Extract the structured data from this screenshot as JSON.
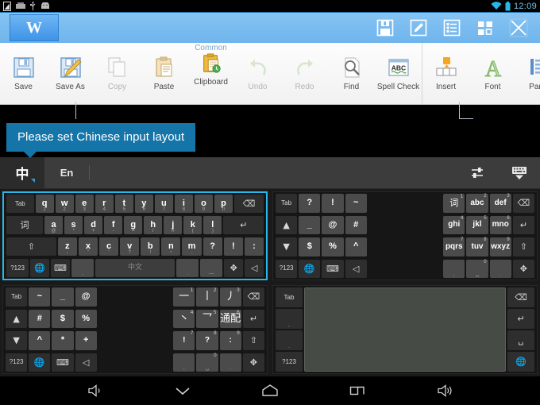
{
  "status_bar": {
    "icons": [
      "screenshot-icon",
      "sdcard-icon",
      "usb-icon",
      "android-debug-icon"
    ],
    "wifi": "wifi-icon",
    "battery": "battery-icon",
    "time": "12:09"
  },
  "title_bar": {
    "app_logo": "W",
    "actions": [
      {
        "name": "save-icon",
        "label": "Save"
      },
      {
        "name": "edit-icon",
        "label": "Edit"
      },
      {
        "name": "outline-icon",
        "label": "Outline"
      },
      {
        "name": "apps-grid-icon",
        "label": "Apps"
      },
      {
        "name": "close-icon",
        "label": "Close"
      }
    ]
  },
  "ribbon": {
    "group_label": "Common",
    "groups": [
      {
        "items": [
          {
            "label": "Save",
            "icon": "floppy-disk-icon",
            "dim": false
          },
          {
            "label": "Save As",
            "icon": "floppy-pencil-icon",
            "dim": false
          },
          {
            "label": "Copy",
            "icon": "copy-pages-icon",
            "dim": true
          },
          {
            "label": "Paste",
            "icon": "clipboard-paste-icon",
            "dim": false
          },
          {
            "label": "Clipboard",
            "icon": "clipboard-clock-icon",
            "dim": false
          },
          {
            "label": "Undo",
            "icon": "undo-arrow-icon",
            "dim": true
          },
          {
            "label": "Redo",
            "icon": "redo-arrow-icon",
            "dim": true
          },
          {
            "label": "Find",
            "icon": "magnifier-page-icon",
            "dim": false
          },
          {
            "label": "Spell Check",
            "icon": "abc-spell-icon",
            "dim": false
          }
        ]
      },
      {
        "items": [
          {
            "label": "Insert",
            "icon": "insert-cell-icon",
            "dim": false
          },
          {
            "label": "Font",
            "icon": "font-a-icon",
            "dim": false
          },
          {
            "label": "Parag",
            "icon": "paragraph-icon",
            "dim": false
          }
        ]
      }
    ]
  },
  "tooltip": {
    "text": "Please set Chinese input layout"
  },
  "ime_bar": {
    "tabs": [
      {
        "label": "中",
        "name": "tab-chinese",
        "active": true
      },
      {
        "label": "En",
        "name": "tab-english",
        "active": false
      }
    ],
    "right_buttons": [
      {
        "name": "ime-settings-icon",
        "label": "Settings"
      },
      {
        "name": "hide-keyboard-icon",
        "label": "Hide keyboard"
      }
    ]
  },
  "keyboards": {
    "qwerty": {
      "name": "qwerty-panel",
      "selected": true,
      "rows": [
        [
          {
            "main": "Tab",
            "fn": true
          },
          {
            "main": "q",
            "sub": "1"
          },
          {
            "main": "w",
            "sub": "2"
          },
          {
            "main": "e",
            "sub": "3"
          },
          {
            "main": "r",
            "sub": "4"
          },
          {
            "main": "t",
            "sub": "5"
          },
          {
            "main": "y",
            "sub": "6"
          },
          {
            "main": "u",
            "sub": "7"
          },
          {
            "main": "i",
            "sub": "8"
          },
          {
            "main": "o",
            "sub": "9"
          },
          {
            "main": "p",
            "sub": "0"
          },
          {
            "main": "⌫",
            "fn": true,
            "glyph": true,
            "name": "backspace-key"
          }
        ],
        [
          {
            "main": "词",
            "fn": true,
            "glyph": true,
            "name": "word-key"
          },
          {
            "main": "a",
            "sub": "@"
          },
          {
            "main": "s",
            "sub": "*"
          },
          {
            "main": "d",
            "sub": "+"
          },
          {
            "main": "f",
            "sub": "-"
          },
          {
            "main": "g",
            "sub": "="
          },
          {
            "main": "h",
            "sub": "/"
          },
          {
            "main": "j",
            "sub": "#"
          },
          {
            "main": "k",
            "sub": "("
          },
          {
            "main": "l",
            "sub": ")"
          },
          {
            "main": "↵",
            "fn": true,
            "glyph": true,
            "name": "enter-key"
          }
        ],
        [
          {
            "main": "⇧",
            "fn": true,
            "glyph": true,
            "name": "shift-key"
          },
          {
            "main": "z",
            "sub": ","
          },
          {
            "main": "x",
            "sub": "\""
          },
          {
            "main": "c",
            "sub": "'"
          },
          {
            "main": "v",
            "sub": "?"
          },
          {
            "main": "b",
            "sub": "!"
          },
          {
            "main": "n",
            "sub": "~"
          },
          {
            "main": "m",
            "sub": "."
          },
          {
            "main": "?",
            "sub": ""
          },
          {
            "main": "!",
            "sub": ""
          },
          {
            "main": ":",
            "sub": ""
          }
        ],
        [
          {
            "main": "?123",
            "fn": true,
            "name": "symbols-key"
          },
          {
            "main": "🌐",
            "fn": true,
            "glyph": true,
            "name": "language-key"
          },
          {
            "main": "⌨",
            "fn": true,
            "glyph": true,
            "name": "keyboard-layout-key"
          },
          {
            "main": "",
            "sub": ",",
            "name": "comma-key"
          },
          {
            "main": "中文",
            "space": true,
            "name": "space-key"
          },
          {
            "main": "",
            "sub": ".",
            "name": "period-key"
          },
          {
            "main": "",
            "sub": "—",
            "name": "dash-key"
          },
          {
            "main": "✥",
            "fn": true,
            "glyph": true,
            "name": "cursor-move-key"
          },
          {
            "main": "◁",
            "fn": true,
            "glyph": true,
            "name": "hide-key"
          }
        ]
      ]
    },
    "t9": {
      "name": "t9-panel",
      "left_rows": [
        [
          {
            "main": "Tab",
            "fn": true
          },
          {
            "main": "?"
          },
          {
            "main": "!"
          },
          {
            "main": "~"
          }
        ],
        [
          {
            "main": "▲",
            "fn": true,
            "glyph": true,
            "name": "page-up-key"
          },
          {
            "main": "_"
          },
          {
            "main": "@"
          },
          {
            "main": "#"
          }
        ],
        [
          {
            "main": "▼",
            "fn": true,
            "glyph": true,
            "name": "page-down-key"
          },
          {
            "main": "$"
          },
          {
            "main": "%"
          },
          {
            "main": "^"
          }
        ],
        [
          {
            "main": "?123",
            "fn": true
          },
          {
            "main": "🌐",
            "fn": true,
            "glyph": true
          },
          {
            "main": "⌨",
            "fn": true,
            "glyph": true
          },
          {
            "main": "◁",
            "fn": true,
            "glyph": true
          }
        ]
      ],
      "pad_rows": [
        [
          {
            "main": "词",
            "sup": "1",
            "glyph": true
          },
          {
            "main": "abc",
            "sup": "2"
          },
          {
            "main": "def",
            "sup": "3"
          },
          {
            "main": "⌫",
            "fn": true,
            "glyph": true,
            "name": "backspace-key"
          }
        ],
        [
          {
            "main": "ghi",
            "sup": "4"
          },
          {
            "main": "jkl",
            "sup": "5"
          },
          {
            "main": "mno",
            "sup": "6"
          },
          {
            "main": "↵",
            "fn": true,
            "glyph": true,
            "name": "enter-key"
          }
        ],
        [
          {
            "main": "pqrs",
            "sup": "7"
          },
          {
            "main": "tuv",
            "sup": "8"
          },
          {
            "main": "wxyz",
            "sup": "9"
          },
          {
            "main": "⇧",
            "fn": true,
            "glyph": true,
            "name": "shift-key"
          }
        ],
        [
          {
            "main": "",
            "sub": ","
          },
          {
            "main": "",
            "sup": "0",
            "sub": "␣"
          },
          {
            "main": "",
            "sub": "."
          },
          {
            "main": "✥",
            "fn": true,
            "glyph": true,
            "name": "cursor-move-key"
          }
        ]
      ]
    },
    "stroke": {
      "name": "stroke-panel",
      "left_rows": [
        [
          {
            "main": "Tab",
            "fn": true
          },
          {
            "main": "~"
          },
          {
            "main": "_"
          },
          {
            "main": "@"
          }
        ],
        [
          {
            "main": "▲",
            "fn": true,
            "glyph": true,
            "name": "page-up-key"
          },
          {
            "main": "#"
          },
          {
            "main": "$"
          },
          {
            "main": "%"
          }
        ],
        [
          {
            "main": "▼",
            "fn": true,
            "glyph": true,
            "name": "page-down-key"
          },
          {
            "main": "^"
          },
          {
            "main": "*"
          },
          {
            "main": "+"
          }
        ],
        [
          {
            "main": "?123",
            "fn": true
          },
          {
            "main": "🌐",
            "fn": true,
            "glyph": true
          },
          {
            "main": "⌨",
            "fn": true,
            "glyph": true
          },
          {
            "main": "◁",
            "fn": true,
            "glyph": true
          }
        ]
      ],
      "pad_rows": [
        [
          {
            "main": "一",
            "sup": "1",
            "stroke": true
          },
          {
            "main": "丨",
            "sup": "2",
            "stroke": true
          },
          {
            "main": "丿",
            "sup": "3",
            "stroke": true
          },
          {
            "main": "⌫",
            "fn": true,
            "glyph": true,
            "name": "backspace-key"
          }
        ],
        [
          {
            "main": "丶",
            "sup": "4",
            "stroke": true
          },
          {
            "main": "乛",
            "sup": "5",
            "stroke": true
          },
          {
            "main": "通配",
            "sup": "6",
            "stroke": true
          },
          {
            "main": "↵",
            "fn": true,
            "glyph": true,
            "name": "enter-key"
          }
        ],
        [
          {
            "main": "!",
            "sup": "7"
          },
          {
            "main": "?",
            "sup": "8"
          },
          {
            "main": ":",
            "sup": "9"
          },
          {
            "main": "⇧",
            "fn": true,
            "glyph": true,
            "name": "shift-key"
          }
        ],
        [
          {
            "main": "",
            "sub": ","
          },
          {
            "main": "",
            "sup": "0",
            "sub": "␣"
          },
          {
            "main": "",
            "sub": "."
          },
          {
            "main": "✥",
            "fn": true,
            "glyph": true,
            "name": "cursor-move-key"
          }
        ]
      ]
    },
    "handwriting": {
      "name": "handwriting-panel",
      "left_keys": [
        {
          "main": "Tab",
          "fn": true
        },
        {
          "main": "",
          "sub": ",",
          "fn": true
        },
        {
          "main": "",
          "sub": ".",
          "fn": true
        },
        {
          "main": "?123",
          "fn": true
        }
      ],
      "right_keys": [
        {
          "main": "⌫",
          "fn": true,
          "glyph": true,
          "name": "backspace-key"
        },
        {
          "main": "↵",
          "fn": true,
          "glyph": true,
          "name": "enter-key"
        },
        {
          "main": "␣",
          "fn": true,
          "glyph": true,
          "name": "space-key"
        },
        {
          "main": "🌐",
          "fn": true,
          "glyph": true,
          "name": "language-key"
        }
      ],
      "pad_label": ""
    }
  },
  "nav_bar": {
    "buttons": [
      {
        "name": "volume-down-icon",
        "label": "Volume down"
      },
      {
        "name": "back-icon",
        "label": "Back"
      },
      {
        "name": "home-icon",
        "label": "Home"
      },
      {
        "name": "recents-icon",
        "label": "Recent apps"
      },
      {
        "name": "volume-up-icon",
        "label": "Volume up"
      }
    ]
  },
  "colors": {
    "accent_blue": "#7bbdf0",
    "tooltip_blue": "#1574a8",
    "selection_cyan": "#29b6e8",
    "keyboard_dark": "#1a1a1a"
  }
}
